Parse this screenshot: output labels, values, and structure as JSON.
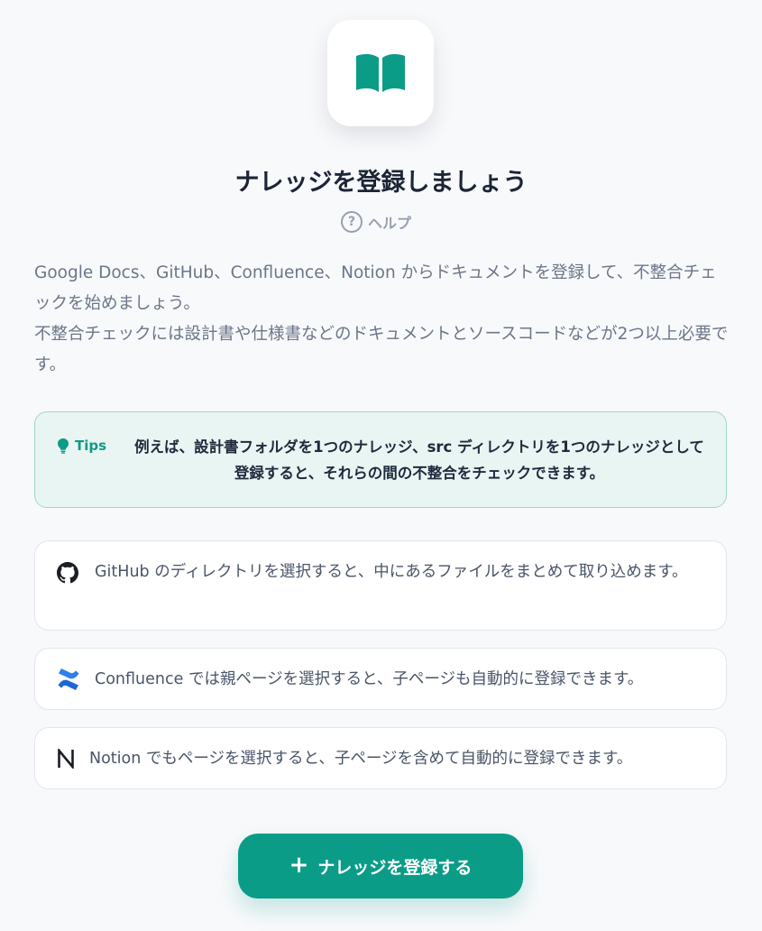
{
  "hero": {
    "icon": "book-open-icon",
    "icon_color": "#0b9c88"
  },
  "title": "ナレッジを登録しましょう",
  "help": {
    "icon": "question-circle-icon",
    "label": "ヘルプ"
  },
  "description": {
    "line1": "Google Docs、GitHub、Confluence、Notion からドキュメントを登録して、不整合チェックを始めましょう。",
    "line2": "不整合チェックには設計書や仕様書などのドキュメントとソースコードなどが2つ以上必要です。"
  },
  "tips": {
    "icon": "lightbulb-icon",
    "label": "Tips",
    "text": "例えば、設計書フォルダを1つのナレッジ、src ディレクトリを1つのナレッジとして登録すると、それらの間の不整合をチェックできます。"
  },
  "sources": [
    {
      "icon": "github-icon",
      "text": "GitHub のディレクトリを選択すると、中にあるファイルをまとめて取り込めます。"
    },
    {
      "icon": "confluence-icon",
      "text": "Confluence では親ページを選択すると、子ページも自動的に登録できます。"
    },
    {
      "icon": "notion-icon",
      "text": "Notion でもページを選択すると、子ページを含めて自動的に登録できます。"
    }
  ],
  "cta": {
    "icon": "plus-icon",
    "label": "ナレッジを登録する"
  },
  "colors": {
    "accent": "#0b9c88",
    "tips_bg": "#e9f5f2",
    "background": "#f8f9fb"
  }
}
